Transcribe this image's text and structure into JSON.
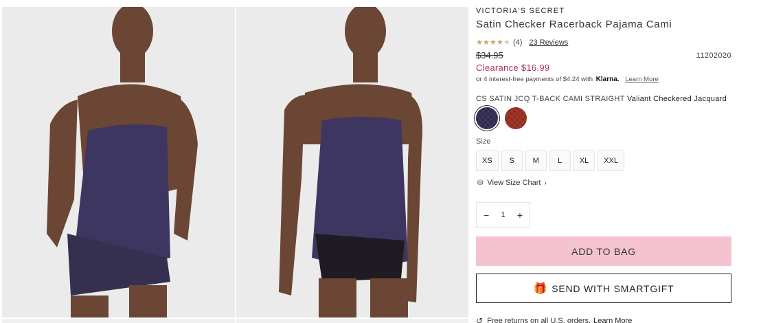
{
  "product": {
    "brand": "VICTORIA'S SECRET",
    "title": "Satin Checker Racerback Pajama Cami",
    "rating": 4,
    "rating_count": "(4)",
    "reviews_label": "23 Reviews",
    "original_price": "$34.95",
    "sku": "11202020",
    "sale_price": "Clearance $16.99",
    "klarna_text": "or 4 interest-free payments of $4.24 with",
    "klarna_logo": "Klarna.",
    "klarna_learn_more": "Learn More",
    "color_code": "CS SATIN JCQ T-BACK CAMI STRAIGHT",
    "color_name": "Valiant Checkered Jacquard",
    "swatches": [
      {
        "name": "Valiant Checkered Jacquard",
        "color": "#3d3660",
        "selected": true
      },
      {
        "name": "red-checkered",
        "color": "#a3382a",
        "selected": false
      }
    ],
    "size_label": "Size",
    "sizes": [
      "XS",
      "S",
      "M",
      "L",
      "XL",
      "XXL"
    ],
    "size_chart_label": "View Size Chart",
    "quantity": "1",
    "add_to_bag_label": "ADD TO BAG",
    "smartgift_label": "SEND WITH SMARTGIFT",
    "returns_text": "Free returns on all U.S. orders.",
    "returns_learn_more": "Learn More"
  },
  "colors": {
    "sale": "#b0306a",
    "add_to_bag_bg": "#f4c3cf",
    "star": "#c9a66b",
    "garment": "#3d3660"
  }
}
